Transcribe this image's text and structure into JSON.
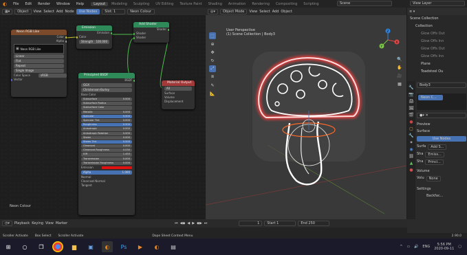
{
  "menu": {
    "items": [
      "File",
      "Edit",
      "Render",
      "Window",
      "Help"
    ],
    "workspaces": [
      "Layout",
      "Modeling",
      "Sculpting",
      "UV Editing",
      "Texture Paint",
      "Shading",
      "Animation",
      "Rendering",
      "Compositing",
      "Scripting"
    ],
    "active_workspace": 0,
    "scene_label": "Scene",
    "view_layer_label": "View Layer"
  },
  "node_editor": {
    "header": {
      "mode": "Object",
      "items": [
        "View",
        "Select",
        "Add",
        "Node"
      ],
      "use_nodes": "Use Nodes",
      "slot": "Slot: 1",
      "material": "Neon Colour"
    },
    "material_label": "Neon Colour",
    "nodes": {
      "neon_rgb": {
        "title": "Neon RGB Like",
        "out_color": "Color",
        "out_alpha": "Alpha",
        "image": "Neon RGB Like",
        "rows": [
          "Linear",
          "Flat",
          "Repeat",
          "Single Image"
        ],
        "color_space_label": "Color Space",
        "color_space": "sRGB",
        "vector": "Vector"
      },
      "emission": {
        "title": "Emission",
        "out": "Emission",
        "in_color": "Color",
        "strength_label": "Strength",
        "strength": "100.000"
      },
      "add_shader": {
        "title": "Add Shader",
        "out": "Shader",
        "in1": "Shader",
        "in2": "Shader"
      },
      "principled": {
        "title": "Principled BSDF",
        "out": "BSDF",
        "dist": "GGX",
        "sss_method": "Christensen-Burley",
        "base_color": "Base Color",
        "rows": [
          {
            "l": "Subsurface",
            "v": "0.000",
            "b": false
          },
          {
            "l": "Subsurface Radius",
            "v": "",
            "b": false
          },
          {
            "l": "Subsurface Color",
            "v": "",
            "b": false
          },
          {
            "l": "Metallic",
            "v": "0.000",
            "b": false
          },
          {
            "l": "Specular",
            "v": "0.500",
            "b": true
          },
          {
            "l": "Specular Tint",
            "v": "0.000",
            "b": false
          },
          {
            "l": "Roughness",
            "v": "0.500",
            "b": true
          },
          {
            "l": "Anisotropic",
            "v": "0.000",
            "b": false
          },
          {
            "l": "Anisotropic Rotation",
            "v": "0.000",
            "b": false
          },
          {
            "l": "Sheen",
            "v": "0.000",
            "b": false
          },
          {
            "l": "Sheen Tint",
            "v": "0.500",
            "b": true
          },
          {
            "l": "Clearcoat",
            "v": "0.000",
            "b": false
          },
          {
            "l": "Clearcoat Roughness",
            "v": "0.030",
            "b": false
          },
          {
            "l": "IOR",
            "v": "1.450",
            "b": false
          },
          {
            "l": "Transmission",
            "v": "0.000",
            "b": false
          },
          {
            "l": "Transmission Roughness",
            "v": "0.000",
            "b": false
          }
        ],
        "emission": "Emission",
        "alpha": "Alpha",
        "alpha_v": "1.000",
        "normal": "Normal",
        "clearcoat_normal": "Clearcoat Normal",
        "tangent": "Tangent"
      },
      "mat_out": {
        "title": "Material Output",
        "target": "All",
        "rows": [
          "Surface",
          "Volume",
          "Displacement"
        ]
      }
    }
  },
  "viewport": {
    "header": {
      "mode": "Object Mode",
      "items": [
        "View",
        "Select",
        "Add",
        "Object"
      ],
      "orientation": "Orientation",
      "orientation_value": "Default",
      "drag": "Drag",
      "select_box": "Select Box",
      "transform": "Global"
    },
    "info_title": "User Perspective",
    "info_sub": "(1) Scene Collection | Body3",
    "axes": {
      "x": "X",
      "y": "Y",
      "z": "Z"
    }
  },
  "outliner": {
    "items": [
      "Scene Collection",
      "Collection",
      "Glow Offs Out",
      "Glow Offs Inn",
      "Glow Offs Out",
      "Glow Offs Inn",
      "Plane",
      "Toadstool Ou"
    ]
  },
  "properties": {
    "object": "Body3",
    "material": "Neon C...",
    "sections": [
      "Preview",
      "Surface"
    ],
    "use_nodes": "Use Nodes",
    "surface_label": "Surfa",
    "surface_value": "Add S...",
    "shader_rows": [
      {
        "l": "Sha",
        "v": "Emiss..."
      },
      {
        "l": "Sha",
        "v": "Princi..."
      }
    ],
    "volume": "Volume",
    "volume_label": "Volu",
    "volume_value": "None",
    "settings": "Settings",
    "backface": "Backfac..."
  },
  "timeline": {
    "playback": "Playback",
    "keying": "Keying",
    "view": "View",
    "marker": "Marker",
    "current_frame": "1",
    "start_label": "Start",
    "start": "1",
    "end_label": "End",
    "end": "250"
  },
  "statusbar": {
    "left": "Scroller Activate",
    "mid": "Box Select",
    "right": "Scroller Activate",
    "notice": "Dope Sheet Context Menu",
    "version": "2.90.0"
  },
  "taskbar": {
    "time": "5:56 PM",
    "date": "2020-09-11",
    "lang": "ENG",
    "icons": [
      "windows-icon",
      "search-icon",
      "task-view-icon",
      "chrome-icon",
      "explorer-icon",
      "files-icon",
      "blender-icon",
      "photoshop-icon",
      "media-icon",
      "blender2-icon",
      "tool-icon"
    ]
  },
  "colors": {
    "accent": "#4772b3",
    "neon_red": "#ff3b3b",
    "emission_red": "#e01010"
  }
}
